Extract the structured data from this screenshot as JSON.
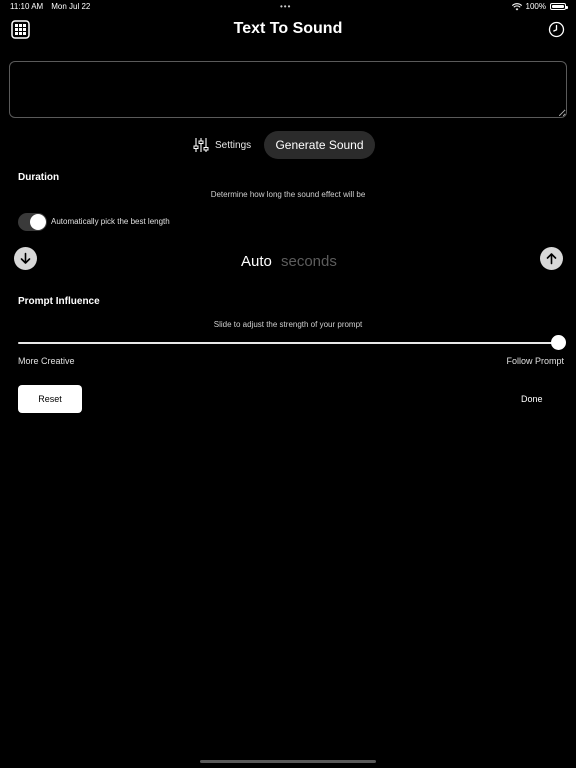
{
  "status_bar": {
    "time": "11:10 AM",
    "date": "Mon Jul 22",
    "dots": "•••",
    "battery_percent": "100%",
    "battery_level": 1.0
  },
  "header": {
    "title": "Text To Sound",
    "left_icon": "grid-icon",
    "right_icon": "history-clock-icon"
  },
  "prompt": {
    "value": "",
    "placeholder": ""
  },
  "toolbar": {
    "settings_label": "Settings",
    "generate_label": "Generate Sound"
  },
  "duration": {
    "heading": "Duration",
    "hint": "Determine how long the sound effect will be",
    "auto_toggle_label": "Automatically pick the best length",
    "auto_toggle_on": true,
    "value": "Auto",
    "unit": "seconds"
  },
  "prompt_influence": {
    "heading": "Prompt Influence",
    "hint": "Slide to adjust the strength of your prompt",
    "min_label": "More Creative",
    "max_label": "Follow Prompt",
    "value": 1.0
  },
  "actions": {
    "reset_label": "Reset",
    "done_label": "Done"
  },
  "colors": {
    "background": "#000000",
    "generate_button": "#2b2b2b",
    "unit_text": "#5c5c5c"
  }
}
